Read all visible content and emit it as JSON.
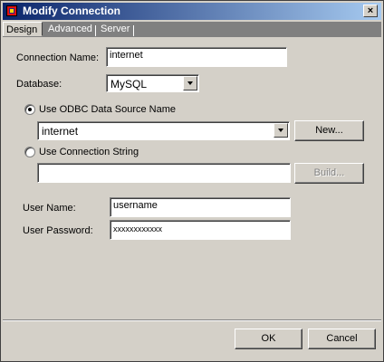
{
  "window": {
    "title": "Modify Connection",
    "close_label": "×"
  },
  "tabs": [
    {
      "label": "Design",
      "active": true
    },
    {
      "label": "Advanced",
      "active": false
    },
    {
      "label": "Server",
      "active": false
    }
  ],
  "form": {
    "connection_name_label": "Connection Name:",
    "connection_name_value": "internet",
    "database_label": "Database:",
    "database_value": "MySQL",
    "use_odbc_label": "Use ODBC Data Source Name",
    "odbc_value": "internet",
    "new_button": "New...",
    "use_conn_string_label": "Use Connection String",
    "conn_string_value": "",
    "build_button": "Build...",
    "user_name_label": "User Name:",
    "user_name_value": "username",
    "user_password_label": "User Password:",
    "user_password_value": "xxxxxxxxxxxx"
  },
  "footer": {
    "ok": "OK",
    "cancel": "Cancel"
  }
}
